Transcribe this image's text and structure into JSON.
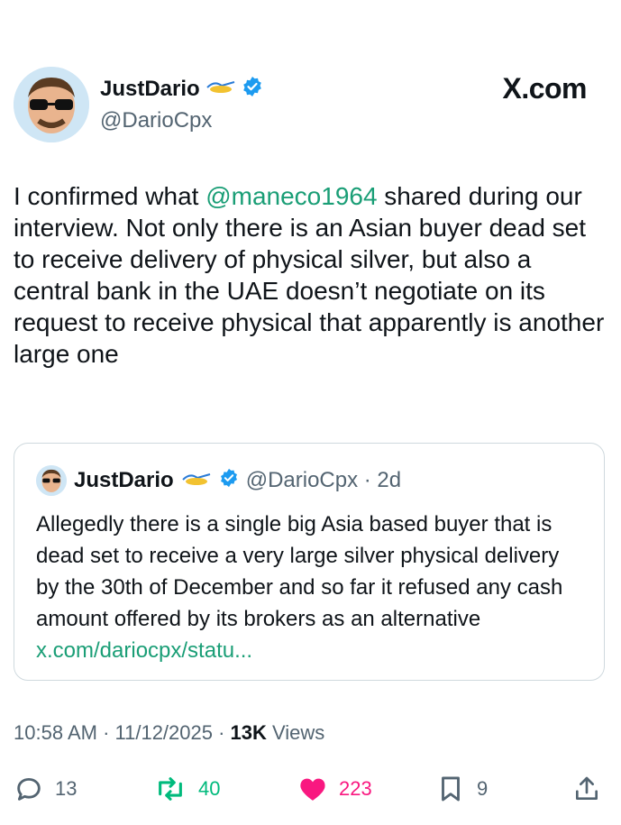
{
  "header": {
    "name": "JustDario",
    "handle": "@DarioCpx",
    "site": "X.com"
  },
  "tweet": {
    "text_before": "I confirmed what ",
    "mention": "@maneco1964",
    "text_after": " shared during our interview. Not only there is an Asian buyer dead set to receive delivery of physical silver, but also a central bank in the UAE doesn’t negotiate on its request to receive physical that apparently is another large one"
  },
  "quote": {
    "name": "JustDario",
    "handle_time": "@DarioCpx · 2d",
    "text": "Allegedly there is a single big Asia based buyer that is dead set to receive a very large silver physical delivery by the 30th of December and so far it refused any cash amount offered by its brokers as an alternative ",
    "link": "x.com/dariocpx/statu..."
  },
  "meta": {
    "time": "10:58 AM · 11/12/2025 · ",
    "views_count": "13K",
    "views_label": " Views"
  },
  "actions": {
    "replies": "13",
    "reposts": "40",
    "likes": "223",
    "bookmarks": "9"
  },
  "colors": {
    "link": "#1a9e76",
    "like": "#f91880",
    "repost": "#00ba7c",
    "verified": "#1d9bf0"
  }
}
